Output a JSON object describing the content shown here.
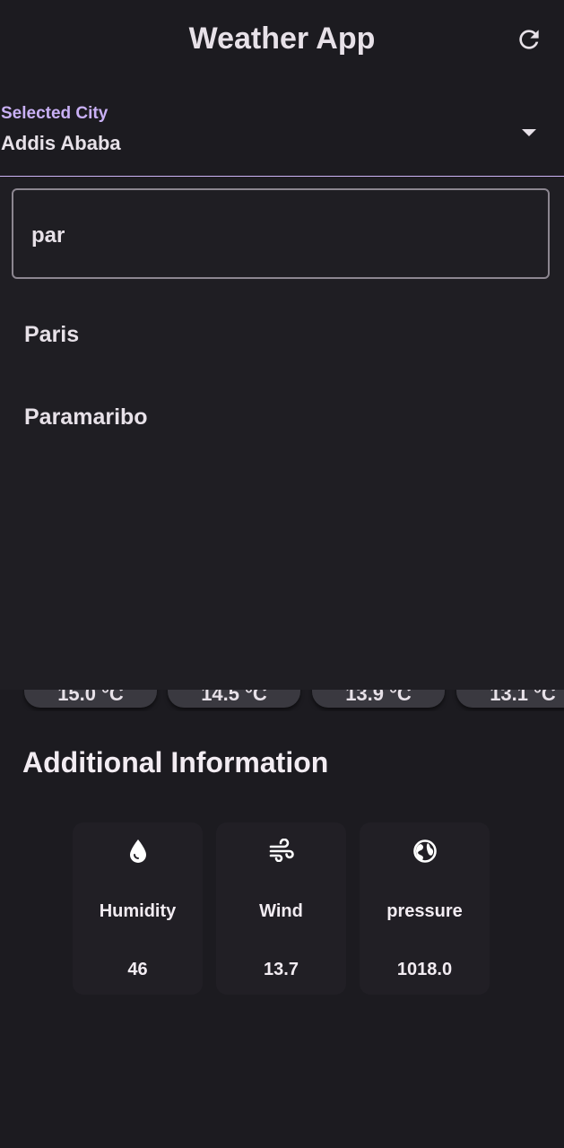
{
  "appbar": {
    "title": "Weather App",
    "refresh_icon": "refresh-icon"
  },
  "city_select": {
    "label": "Selected City",
    "value": "Addis Ababa",
    "caret_icon": "caret-down-icon"
  },
  "dropdown": {
    "search_value": "par",
    "options": [
      {
        "label": "Paris"
      },
      {
        "label": "Paramaribo"
      }
    ]
  },
  "forecast": {
    "temps": [
      {
        "label": "15.0 °C"
      },
      {
        "label": "14.5 °C"
      },
      {
        "label": "13.9 °C"
      },
      {
        "label": "13.1 °C"
      }
    ]
  },
  "additional": {
    "title": "Additional Information",
    "cards": [
      {
        "icon": "water-drop-icon",
        "label": "Humidity",
        "value": "46"
      },
      {
        "icon": "wind-icon",
        "label": "Wind",
        "value": "13.7"
      },
      {
        "icon": "globe-icon",
        "label": "pressure",
        "value": "1018.0"
      }
    ]
  },
  "colors": {
    "background": "#1c1b20",
    "accent": "#cdb4f6",
    "text": "#e7e1e8",
    "chip": "#3a3940",
    "card": "#211f25"
  }
}
